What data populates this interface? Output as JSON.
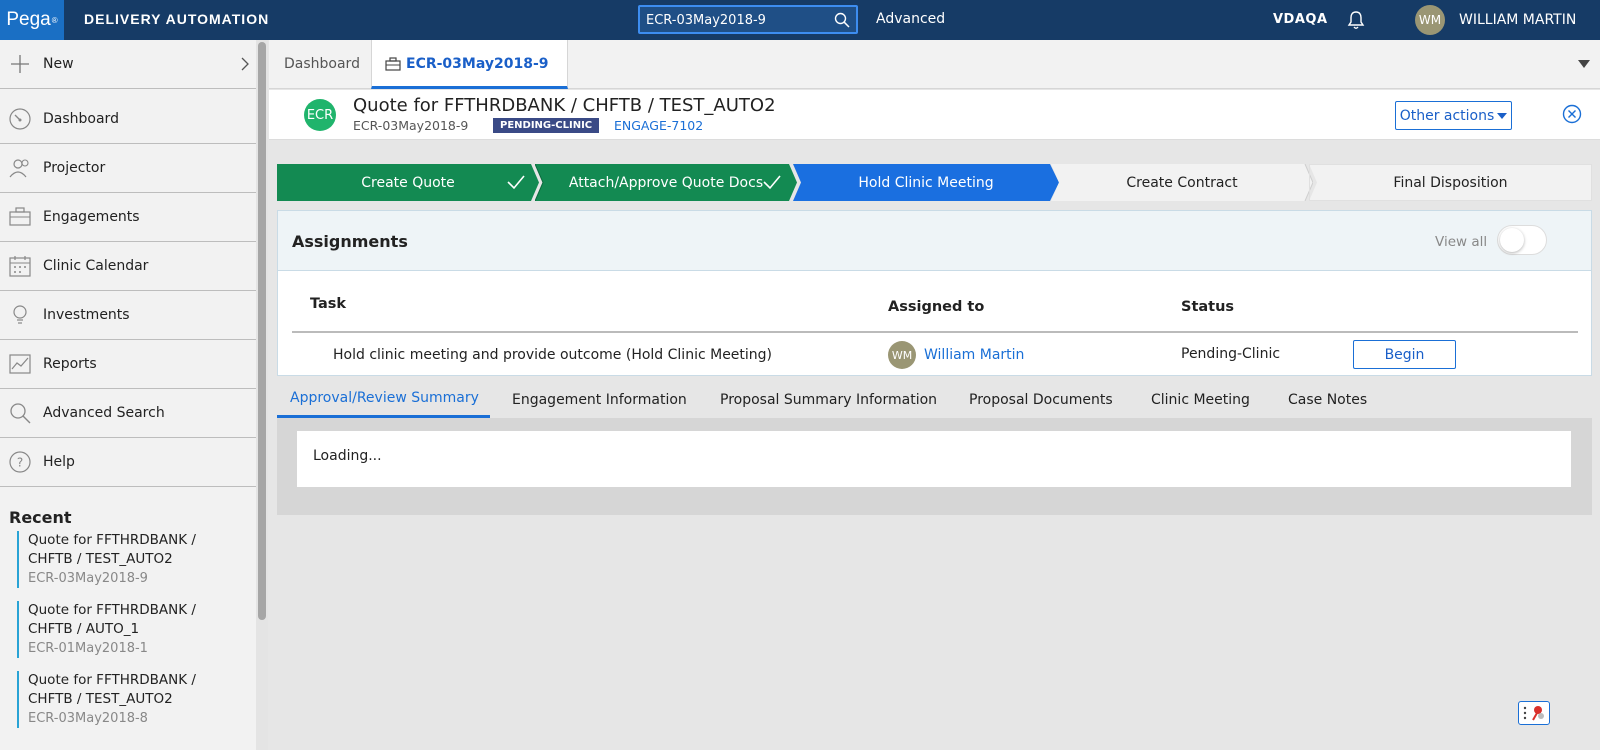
{
  "header": {
    "logo_text": "Pega",
    "logo_mark": "®",
    "app_title": "DELIVERY AUTOMATION",
    "search_value": "ECR-03May2018-9",
    "advanced_label": "Advanced",
    "environment": "VDAQA",
    "user_initials": "WM",
    "user_name": "WILLIAM MARTIN"
  },
  "sidebar": {
    "items": [
      {
        "label": "New",
        "icon": "plus-icon"
      },
      {
        "label": "Dashboard",
        "icon": "gauge-icon"
      },
      {
        "label": "Projector",
        "icon": "people-icon"
      },
      {
        "label": "Engagements",
        "icon": "briefcase-icon"
      },
      {
        "label": "Clinic Calendar",
        "icon": "calendar-icon"
      },
      {
        "label": "Investments",
        "icon": "lightbulb-icon"
      },
      {
        "label": "Reports",
        "icon": "chart-icon"
      },
      {
        "label": "Advanced Search",
        "icon": "search-icon"
      },
      {
        "label": "Help",
        "icon": "help-icon"
      }
    ],
    "recent_title": "Recent",
    "recent": [
      {
        "title_line1": "Quote for FFTHRDBANK /",
        "title_line2": "CHFTB / TEST_AUTO2",
        "id": "ECR-03May2018-9"
      },
      {
        "title_line1": "Quote for FFTHRDBANK /",
        "title_line2": "CHFTB / AUTO_1",
        "id": "ECR-01May2018-1"
      },
      {
        "title_line1": "Quote for FFTHRDBANK /",
        "title_line2": "CHFTB / TEST_AUTO2",
        "id": "ECR-03May2018-8"
      }
    ]
  },
  "tabs": {
    "dashboard": "Dashboard",
    "active": "ECR-03May2018-9"
  },
  "case": {
    "badge": "ECR",
    "title": "Quote for FFTHRDBANK / CHFTB / TEST_AUTO2",
    "id": "ECR-03May2018-9",
    "status": "PENDING-CLINIC",
    "engagement": "ENGAGE-7102",
    "other_actions": "Other actions"
  },
  "stages": [
    {
      "label": "Create Quote",
      "state": "done"
    },
    {
      "label": "Attach/Approve Quote Docs",
      "state": "done"
    },
    {
      "label": "Hold Clinic Meeting",
      "state": "current"
    },
    {
      "label": "Create Contract",
      "state": "future"
    },
    {
      "label": "Final Disposition",
      "state": "future"
    }
  ],
  "colors": {
    "stage_done": "#138a52",
    "stage_current": "#1a6fe0",
    "stage_future": "#f2f2f2",
    "header_bg": "#163b66",
    "accent": "#1a6fd6"
  },
  "assignments": {
    "title": "Assignments",
    "view_all": "View all",
    "view_all_on": false,
    "col_task": "Task",
    "col_assigned": "Assigned to",
    "col_status": "Status",
    "rows": [
      {
        "task": "Hold clinic meeting and provide outcome (Hold Clinic Meeting)",
        "assignee_initials": "WM",
        "assignee": "William Martin",
        "status": "Pending-Clinic",
        "action": "Begin"
      }
    ]
  },
  "subtabs": [
    "Approval/Review Summary",
    "Engagement Information",
    "Proposal Summary Information",
    "Proposal Documents",
    "Clinic Meeting",
    "Case Notes"
  ],
  "panel": {
    "loading": "Loading..."
  }
}
